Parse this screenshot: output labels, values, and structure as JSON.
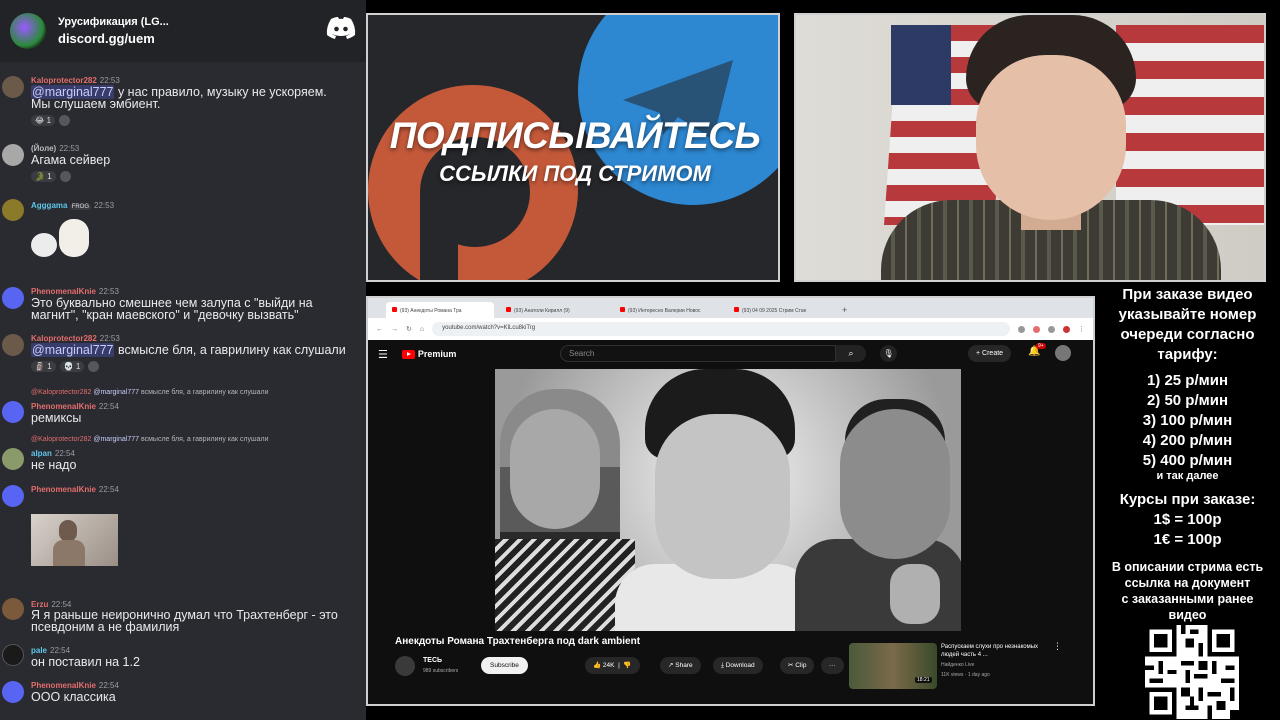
{
  "chat": {
    "server_name": "Урусификация (LG...",
    "invite": "discord.gg/uem",
    "messages": [
      {
        "name": "Kaloprotector282",
        "name_color": "#e36d6d",
        "time": "22:53",
        "text_mention": "@marginal777",
        "text": " у нас правило, музыку не ускоряем.\nМы слушаем эмбиент.",
        "reaction": "1"
      },
      {
        "name": "(Йоле)",
        "name_color": "#b9bbbe",
        "time": "22:53",
        "text": "Агама сейвер",
        "reaction": "1"
      },
      {
        "name": "Agggama",
        "name_color": "#5ec6e8",
        "time": "22:53",
        "badge": "FROG"
      },
      {
        "name": "PhenomenalKnie",
        "name_color": "#e36d6d",
        "time": "22:53",
        "text": "Это буквально смешнее чем залупа с \"выйди на\nмагнит\", \"кран маевского\" и \"девочку вызвать\""
      },
      {
        "name": "Kaloprotector282",
        "name_color": "#e36d6d",
        "time": "22:53",
        "text_mention": "@marginal777",
        "text": " всмысле бля, а гаврилину как слушали",
        "reactions": [
          "1",
          "1"
        ]
      },
      {
        "reply_name": "@Kaloprotector282",
        "reply_mention": "@marginal777",
        "reply_text": " всмысле бля, а гаврилину как слушали",
        "name": "PhenomenalKnie",
        "name_color": "#e36d6d",
        "time": "22:54",
        "text": "ремиксы"
      },
      {
        "reply_name": "@Kaloprotector282",
        "reply_mention": "@marginal777",
        "reply_text": " всмысле бля, а гаврилину как слушали",
        "name": "alpan",
        "name_color": "#5ec6e8",
        "time": "22:54",
        "text": "не надо"
      },
      {
        "name": "PhenomenalKnie",
        "name_color": "#e36d6d",
        "time": "22:54"
      },
      {
        "name": "Erzu",
        "name_color": "#e36d6d",
        "time": "22:54",
        "text": "Я я раньше неиронично думал что Трахтенберг - это\nпсевдоним а не фамилия"
      },
      {
        "name": "pale",
        "name_color": "#5ec6e8",
        "time": "22:54",
        "text": "он поставил на 1.2"
      },
      {
        "name": "PhenomenalKnie",
        "name_color": "#e36d6d",
        "time": "22:54",
        "text": "ООО классика"
      }
    ]
  },
  "banner": {
    "title": "ПОДПИСЫВАЙТЕСЬ",
    "subtitle": "ССЫЛКИ ПОД СТРИМОМ"
  },
  "browser": {
    "tabs": [
      "(93) Анекдоты Романа Тра",
      "(93) Анатоли Кирилл (9)",
      "(93) Интересно Валерии Новос",
      "(93) 04 09 2025 Стрим Стаe"
    ],
    "url": "youtube.com/watch?v=KlLcu8kiTrg",
    "yt_label": "Premium",
    "search_placeholder": "Search",
    "create_label": "Create",
    "notif_count": "9+",
    "video_title": "Анекдоты Романа Трахтенберга под dark ambient",
    "channel_name": "ТЕСЬ",
    "channel_subs": "989 subscribers",
    "subscribe": "Subscribe",
    "likes": "24K",
    "share": "Share",
    "download": "Download",
    "clip": "Clip",
    "rec_title": "Распускаем слухи про незнакомых людей часть 4 ...",
    "rec_channel": "Найденко Live",
    "rec_meta": "11K views · 1 day ago",
    "rec_duration": "18:21"
  },
  "info": {
    "lines": [
      "При заказе видео",
      "указывайте номер",
      "очереди согласно",
      "тарифу:",
      "1) 25 р/мин",
      "2) 50 р/мин",
      "3) 100 р/мин",
      "4) 200 р/мин",
      "5) 400 р/мин"
    ],
    "etc": "и так далее",
    "rates_title": "Курсы при заказе:",
    "rate1": "1$ = 100р",
    "rate2": "1€ = 100р",
    "desc": [
      "В описании стрима есть",
      "ссылка на документ",
      "с заказанными ранее",
      "видео"
    ]
  },
  "colors": {
    "discord_blurple": "#5865f2",
    "youtube_red": "#ff0000",
    "telegram_blue": "#2d87d1",
    "patreon_orange": "#e1633d"
  }
}
